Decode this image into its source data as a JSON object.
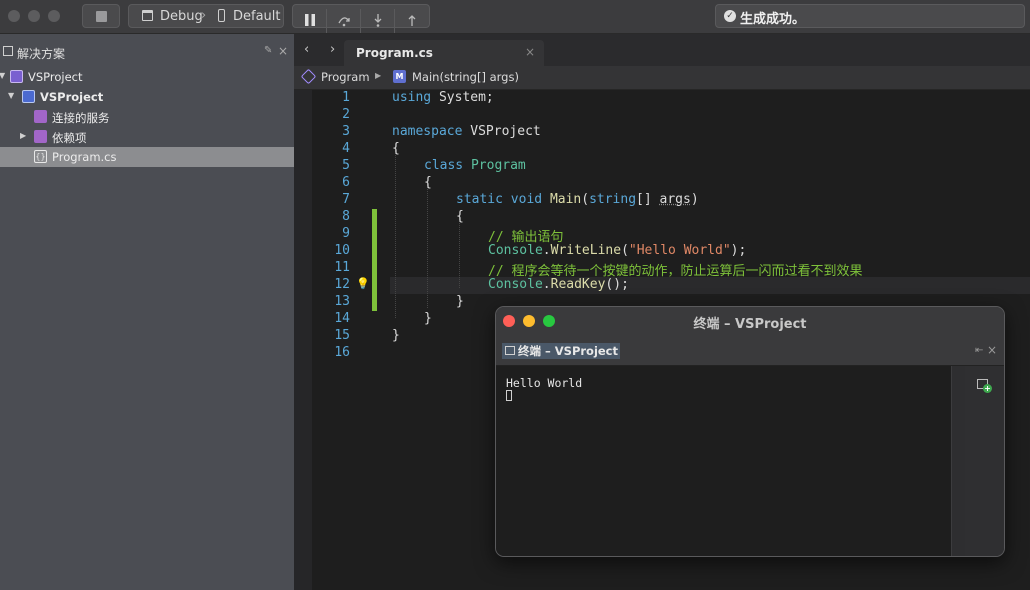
{
  "toolbar": {
    "config_label": "Debug",
    "separator": "›",
    "device_label": "Default",
    "status_text": "生成成功。"
  },
  "sidebar": {
    "title": "解决方案",
    "pin_icon": "pin-icon",
    "close_label": "×",
    "items": [
      {
        "label": "VSProject",
        "level": 0,
        "expanded": true,
        "icon": "solution-icon"
      },
      {
        "label": "VSProject",
        "level": 1,
        "expanded": true,
        "icon": "project-icon",
        "bold": true
      },
      {
        "label": "连接的服务",
        "level": 2,
        "icon": "connected-services-icon"
      },
      {
        "label": "依赖项",
        "level": 2,
        "expanded": false,
        "icon": "dependencies-icon"
      },
      {
        "label": "Program.cs",
        "level": 2,
        "icon": "csharp-file-icon",
        "selected": true
      }
    ]
  },
  "editor": {
    "nav_back": "‹",
    "nav_forward": "›",
    "tab_label": "Program.cs",
    "tab_close": "×",
    "breadcrumb": {
      "class_name": "Program",
      "method_name": "Main(string[] args)"
    },
    "line_numbers": [
      "1",
      "2",
      "3",
      "4",
      "5",
      "6",
      "7",
      "8",
      "9",
      "10",
      "11",
      "12",
      "13",
      "14",
      "15",
      "16"
    ],
    "code": {
      "l1_kw": "using",
      "l1_rest": " System;",
      "l3_kw": "namespace",
      "l3_rest": " VSProject",
      "l4": "{",
      "l5_kw": "class",
      "l5_type": "Program",
      "l6": "{",
      "l7_kw1": "static",
      "l7_kw2": "void",
      "l7_fn": "Main",
      "l7_kw3": "string",
      "l7_arr": "[]",
      "l7_arg": "args",
      "l7_close": ")",
      "l8": "{",
      "l9_comment": "// 输出语句",
      "l10_type": "Console",
      "l10_fn": "WriteLine",
      "l10_str": "\"Hello World\"",
      "l10_end": ");",
      "l11_comment": "// 程序会等待一个按键的动作，防止运算后一闪而过看不到效果",
      "l12_type": "Console",
      "l12_fn": "ReadKey",
      "l12_end": "();",
      "l13": "}",
      "l14": "}",
      "l15": "}"
    }
  },
  "terminal": {
    "title": "终端 – VSProject",
    "tab_label": "终端 – VSProject",
    "output": "Hello World"
  },
  "colors": {
    "keyword": "#5aa8d8",
    "type": "#5dc1a0",
    "string": "#e08866",
    "comment": "#7ec23a",
    "close_red": "#ff5f57",
    "minimize_yellow": "#febc2e",
    "zoom_green": "#28c840"
  }
}
